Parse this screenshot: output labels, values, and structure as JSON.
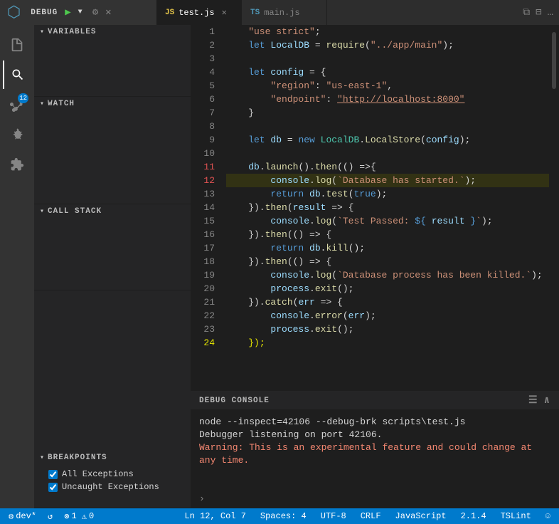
{
  "topBar": {
    "debugLabel": "DEBUG",
    "tabs": [
      {
        "id": "test-js",
        "icon": "JS",
        "label": "test.js",
        "active": true,
        "modified": false
      },
      {
        "id": "main-js",
        "icon": "TS",
        "label": "main.js",
        "active": false,
        "modified": false
      }
    ],
    "tabBarIcons": [
      "split-icon",
      "layout-icon",
      "more-icon"
    ]
  },
  "activityBar": {
    "icons": [
      {
        "name": "file-explorer-icon",
        "symbol": "⎘",
        "active": false
      },
      {
        "name": "search-icon",
        "symbol": "🔍",
        "active": true
      },
      {
        "name": "source-control-icon",
        "symbol": "⑂",
        "active": false,
        "badge": "12"
      },
      {
        "name": "run-debug-icon",
        "symbol": "▶",
        "active": false
      },
      {
        "name": "extensions-icon",
        "symbol": "⊞",
        "active": false
      }
    ]
  },
  "sidebar": {
    "sections": [
      {
        "id": "variables",
        "header": "VARIABLES",
        "expanded": true,
        "items": []
      },
      {
        "id": "watch",
        "header": "WATCH",
        "expanded": true,
        "items": []
      },
      {
        "id": "callStack",
        "header": "CALL STACK",
        "expanded": true,
        "items": []
      },
      {
        "id": "breakpoints",
        "header": "BREAKPOINTS",
        "expanded": true,
        "items": [
          {
            "id": "all-exceptions",
            "label": "All Exceptions",
            "checked": true
          },
          {
            "id": "uncaught-exceptions",
            "label": "Uncaught Exceptions",
            "checked": true
          }
        ]
      }
    ]
  },
  "editor": {
    "lines": [
      {
        "num": 1,
        "content": "    \"use strict\";",
        "breakpoint": false
      },
      {
        "num": 2,
        "content": "    let LocalDB = require(\"../app/main\");",
        "breakpoint": false
      },
      {
        "num": 3,
        "content": "",
        "breakpoint": false
      },
      {
        "num": 4,
        "content": "    let config = {",
        "breakpoint": false
      },
      {
        "num": 5,
        "content": "        \"region\": \"us-east-1\",",
        "breakpoint": false
      },
      {
        "num": 6,
        "content": "        \"endpoint\": \"http://localhost:8000\"",
        "breakpoint": false
      },
      {
        "num": 7,
        "content": "    }",
        "breakpoint": false
      },
      {
        "num": 8,
        "content": "",
        "breakpoint": false
      },
      {
        "num": 9,
        "content": "    let db = new LocalDB.LocalStore(config);",
        "breakpoint": false
      },
      {
        "num": 10,
        "content": "",
        "breakpoint": false
      },
      {
        "num": 11,
        "content": "    db.launch().then(() =>{",
        "breakpoint": false
      },
      {
        "num": 12,
        "content": "        console.log(`Database has started.`);",
        "breakpoint": true
      },
      {
        "num": 13,
        "content": "        return db.test(true);",
        "breakpoint": false
      },
      {
        "num": 14,
        "content": "    }).then(result => {",
        "breakpoint": false
      },
      {
        "num": 15,
        "content": "        console.log(`Test Passed: ${ result }`);",
        "breakpoint": false
      },
      {
        "num": 16,
        "content": "    }).then(() => {",
        "breakpoint": false
      },
      {
        "num": 17,
        "content": "        return db.kill();",
        "breakpoint": false
      },
      {
        "num": 18,
        "content": "    }).then(() => {",
        "breakpoint": false
      },
      {
        "num": 19,
        "content": "        console.log(`Database process has been killed.`);",
        "breakpoint": false
      },
      {
        "num": 20,
        "content": "        process.exit();",
        "breakpoint": false
      },
      {
        "num": 21,
        "content": "    }).catch(err => {",
        "breakpoint": false
      },
      {
        "num": 22,
        "content": "        console.error(err);",
        "breakpoint": false
      },
      {
        "num": 23,
        "content": "        process.exit();",
        "breakpoint": false
      },
      {
        "num": 24,
        "content": "    });",
        "breakpoint": false
      }
    ]
  },
  "debugConsole": {
    "title": "DEBUG CONSOLE",
    "lines": [
      {
        "text": "node --inspect=42106 --debug-brk scripts\\test.js",
        "type": "normal"
      },
      {
        "text": "Debugger listening on port 42106.",
        "type": "normal"
      },
      {
        "text": "Warning: This is an experimental feature and could change at any time.",
        "type": "warning"
      }
    ]
  },
  "statusBar": {
    "left": [
      {
        "id": "dev-item",
        "text": "⚙ dev*"
      },
      {
        "id": "sync-item",
        "text": "↺"
      },
      {
        "id": "errors-item",
        "text": "⊗ 1  ⚠ 0"
      }
    ],
    "right": [
      {
        "id": "position",
        "text": "Ln 12, Col 7"
      },
      {
        "id": "spaces",
        "text": "Spaces: 4"
      },
      {
        "id": "encoding",
        "text": "UTF-8"
      },
      {
        "id": "eol",
        "text": "CRLF"
      },
      {
        "id": "language",
        "text": "JavaScript"
      },
      {
        "id": "version",
        "text": "2.1.4"
      },
      {
        "id": "tslint",
        "text": "TSLint"
      },
      {
        "id": "smiley",
        "text": "☺"
      }
    ]
  }
}
